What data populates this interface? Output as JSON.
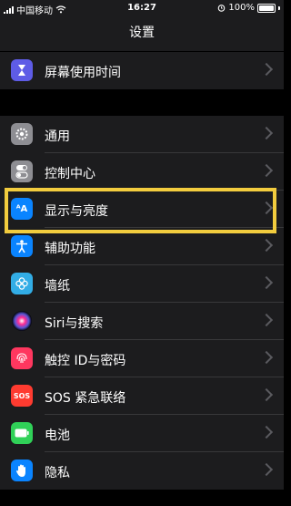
{
  "status_bar": {
    "carrier": "中国移动",
    "time": "16:27",
    "battery": "100%"
  },
  "nav": {
    "title": "设置"
  },
  "groups": [
    {
      "items": [
        {
          "label": "屏幕使用时间",
          "icon": "hourglass-icon",
          "color": "#5e5ce6"
        }
      ]
    },
    {
      "items": [
        {
          "label": "通用",
          "icon": "gear-icon",
          "color": "#8e8e93"
        },
        {
          "label": "控制中心",
          "icon": "toggles-icon",
          "color": "#8e8e93"
        },
        {
          "label": "显示与亮度",
          "icon": "text-size-icon",
          "color": "#0a84ff"
        },
        {
          "label": "辅助功能",
          "icon": "accessibility-icon",
          "color": "#0a84ff"
        },
        {
          "label": "墙纸",
          "icon": "flower-icon",
          "color": "#32ade6"
        },
        {
          "label": "Siri与搜索",
          "icon": "siri-icon",
          "color": "#1c1c1e"
        },
        {
          "label": "触控 ID与密码",
          "icon": "fingerprint-icon",
          "color": "#ff375f"
        },
        {
          "label": "SOS 紧急联络",
          "icon": "sos-icon",
          "color": "#ff3b30"
        },
        {
          "label": "电池",
          "icon": "battery-icon",
          "color": "#30d158"
        },
        {
          "label": "隐私",
          "icon": "hand-icon",
          "color": "#0a84ff"
        }
      ]
    }
  ],
  "highlight_color": "#f2cc3e"
}
